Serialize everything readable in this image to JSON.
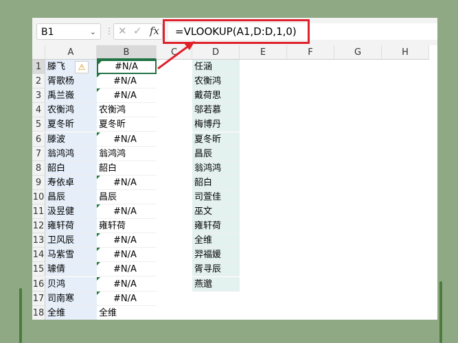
{
  "name_box": "B1",
  "fx_label": "fx",
  "cancel_icon": "✕",
  "confirm_icon": "✓",
  "formula": "=VLOOKUP(A1,D:D,1,0)",
  "columns": [
    "A",
    "B",
    "C",
    "D",
    "E",
    "F",
    "G",
    "H"
  ],
  "rows": [
    {
      "n": "1",
      "a": "滕飞",
      "b": "#N/A",
      "b_err": true,
      "d": "任涵"
    },
    {
      "n": "2",
      "a": "胥歌杨",
      "b": "#N/A",
      "b_err": true,
      "d": "农衡鸿"
    },
    {
      "n": "3",
      "a": "禹兰嶶",
      "b": "#N/A",
      "b_err": true,
      "d": "戴荷思"
    },
    {
      "n": "4",
      "a": "农衡鸿",
      "b": "农衡鸿",
      "b_err": false,
      "d": "邬若慕"
    },
    {
      "n": "5",
      "a": "夏冬昕",
      "b": "夏冬昕",
      "b_err": false,
      "d": "梅博丹"
    },
    {
      "n": "6",
      "a": "滕波",
      "b": "#N/A",
      "b_err": true,
      "d": "夏冬昕"
    },
    {
      "n": "7",
      "a": "翁鸿鸿",
      "b": "翁鸿鸿",
      "b_err": false,
      "d": "昌辰"
    },
    {
      "n": "8",
      "a": "韶白",
      "b": "韶白",
      "b_err": false,
      "d": "翁鸿鸿"
    },
    {
      "n": "9",
      "a": "寿依卓",
      "b": "#N/A",
      "b_err": true,
      "d": "韶白"
    },
    {
      "n": "10",
      "a": "昌辰",
      "b": "昌辰",
      "b_err": false,
      "d": "司萱佳"
    },
    {
      "n": "11",
      "a": "汲昱健",
      "b": "#N/A",
      "b_err": true,
      "d": "巫文"
    },
    {
      "n": "12",
      "a": "雍轩荷",
      "b": "雍轩荷",
      "b_err": false,
      "d": "雍轩荷"
    },
    {
      "n": "13",
      "a": "卫风辰",
      "b": "#N/A",
      "b_err": true,
      "d": "全维"
    },
    {
      "n": "14",
      "a": "马紫雪",
      "b": "#N/A",
      "b_err": true,
      "d": "羿福媛"
    },
    {
      "n": "15",
      "a": "璩倩",
      "b": "#N/A",
      "b_err": true,
      "d": "胥寻辰"
    },
    {
      "n": "16",
      "a": "贝鸿",
      "b": "#N/A",
      "b_err": true,
      "d": "燕邈"
    },
    {
      "n": "17",
      "a": "司南寒",
      "b": "#N/A",
      "b_err": true,
      "d": ""
    },
    {
      "n": "18",
      "a": "全维",
      "b": "全维",
      "b_err": false,
      "d": ""
    }
  ],
  "colors": {
    "accent": "#217346",
    "highlight": "#e0202a"
  }
}
